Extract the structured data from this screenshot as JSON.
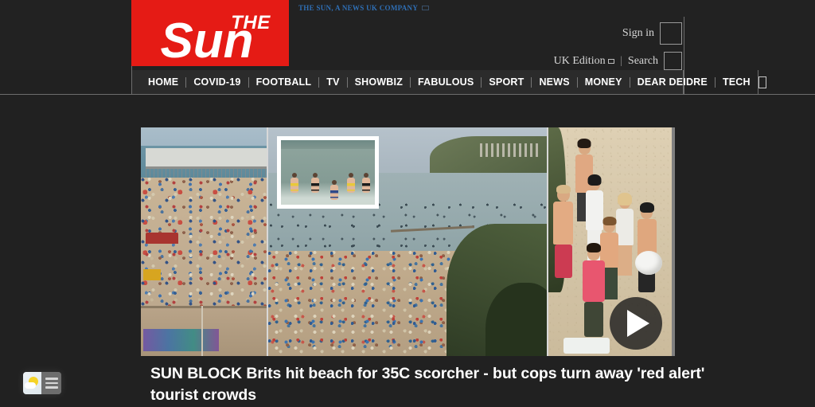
{
  "site": {
    "logo_text": "THE Sun",
    "logo_word_small": "THE",
    "logo_word_main": "Sun",
    "logo_bg_color": "#e51b15",
    "company_line": "THE SUN, A NEWS UK COMPANY",
    "page_bg_color": "#212121",
    "nav_bg_color": "#2b2b2b"
  },
  "account": {
    "sign_in_label": "Sign in",
    "edition_label": "UK Edition",
    "divider": "|",
    "search_label": "Search"
  },
  "nav": {
    "items": [
      {
        "label": "HOME"
      },
      {
        "label": "COVID-19"
      },
      {
        "label": "FOOTBALL"
      },
      {
        "label": "TV"
      },
      {
        "label": "SHOWBIZ"
      },
      {
        "label": "FABULOUS"
      },
      {
        "label": "SPORT"
      },
      {
        "label": "NEWS"
      },
      {
        "label": "MONEY"
      },
      {
        "label": "DEAR DEIDRE"
      },
      {
        "label": "TECH"
      }
    ]
  },
  "article": {
    "headline_kicker": "SUN BLOCK",
    "headline": "SUN BLOCK Brits hit beach for 35C scorcher - but cops turn away 'red alert' tourist crowds",
    "media": {
      "type": "video",
      "play_label": "Play",
      "panels": [
        {
          "caption": "Aerial view of packed beach beside a pier"
        },
        {
          "caption": "Wide view of a crowded beach and headland, with inset of swimmers in the sea"
        },
        {
          "caption": "Group of young people standing on the sand"
        }
      ]
    }
  },
  "taskbar": {
    "widget_label": "Weather and news",
    "weather_icon": "sun-cloud-icon",
    "menu_icon": "hamburger-icon"
  }
}
